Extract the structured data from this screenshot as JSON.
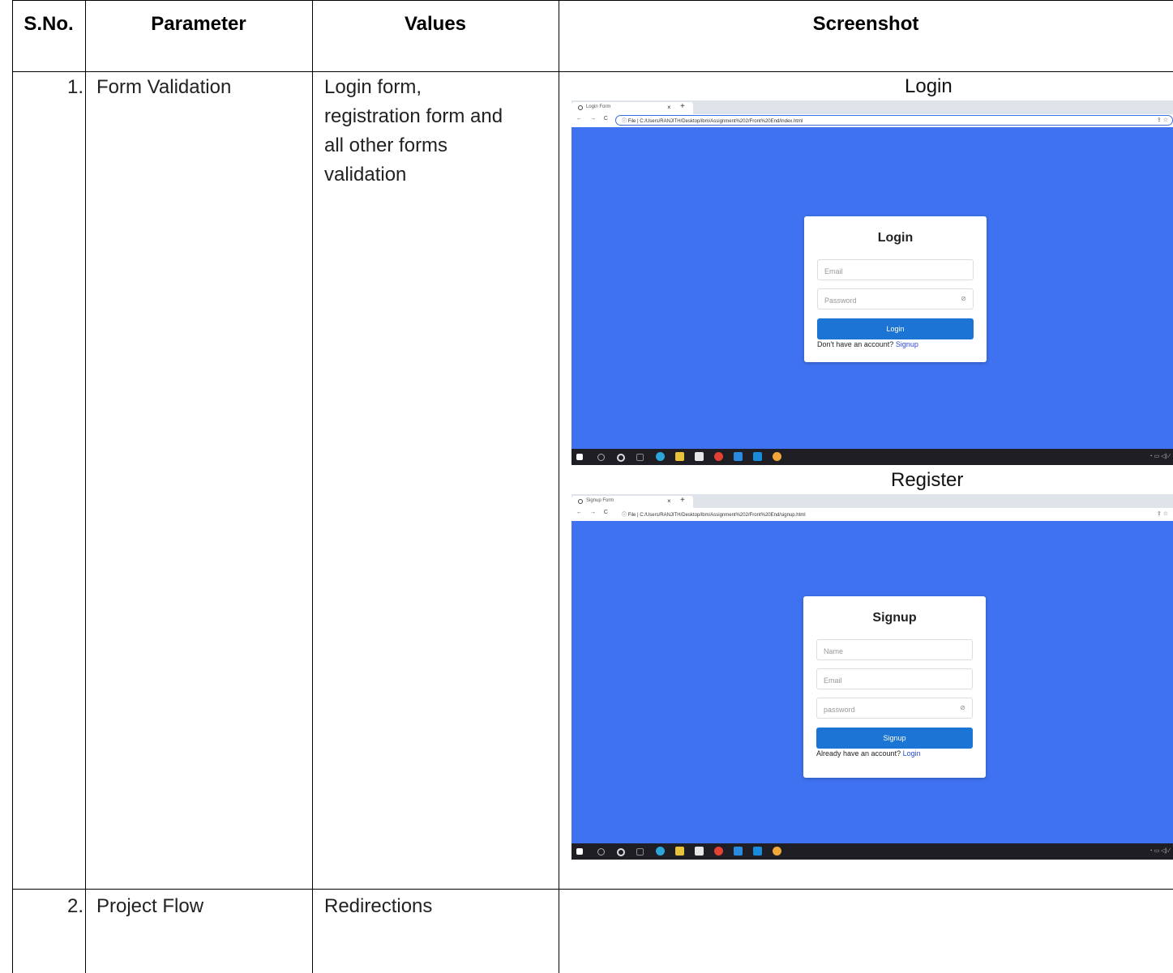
{
  "table": {
    "headers": [
      "S.No.",
      "Parameter",
      "Values",
      "Screenshot"
    ],
    "rows": [
      {
        "sno": "1.",
        "parameter": "Form Validation",
        "values": [
          "Login form,",
          "registration form and",
          "all other forms",
          "validation"
        ]
      },
      {
        "sno": "2.",
        "parameter": "Project Flow",
        "values": [
          "Redirections"
        ]
      }
    ]
  },
  "login_shot": {
    "caption": "Login",
    "tab_title": "Login Form",
    "nav": "← → C",
    "url": "ⓘ File | C:/Users/RANJITH/Desktop/ibm/Assignment%202/Front%20End/index.html",
    "card_title": "Login",
    "email_placeholder": "Email",
    "password_placeholder": "Password",
    "button": "Login",
    "footer_text": "Don't have an account?",
    "footer_link": "Signup"
  },
  "register_shot": {
    "caption": "Register",
    "tab_title": "Signup Form",
    "nav": "← → C",
    "url": "ⓘ File | C:/Users/RANJITH/Desktop/ibm/Assignment%202/Front%20End/signup.html",
    "card_title": "Signup",
    "name_placeholder": "Name",
    "email_placeholder": "Email",
    "password_placeholder": "password",
    "button": "Signup",
    "footer_text": "Already have an account?",
    "footer_link": "Login"
  },
  "colors": {
    "page_bg": "#3f72f0",
    "button": "#1c74d4",
    "taskbar": "#1e1e24",
    "link": "#2a4ad0"
  },
  "icons": [
    "site-info-icon",
    "eye-off-icon",
    "windows-start-icon",
    "taskbar-app-icon",
    "system-tray-icons"
  ]
}
